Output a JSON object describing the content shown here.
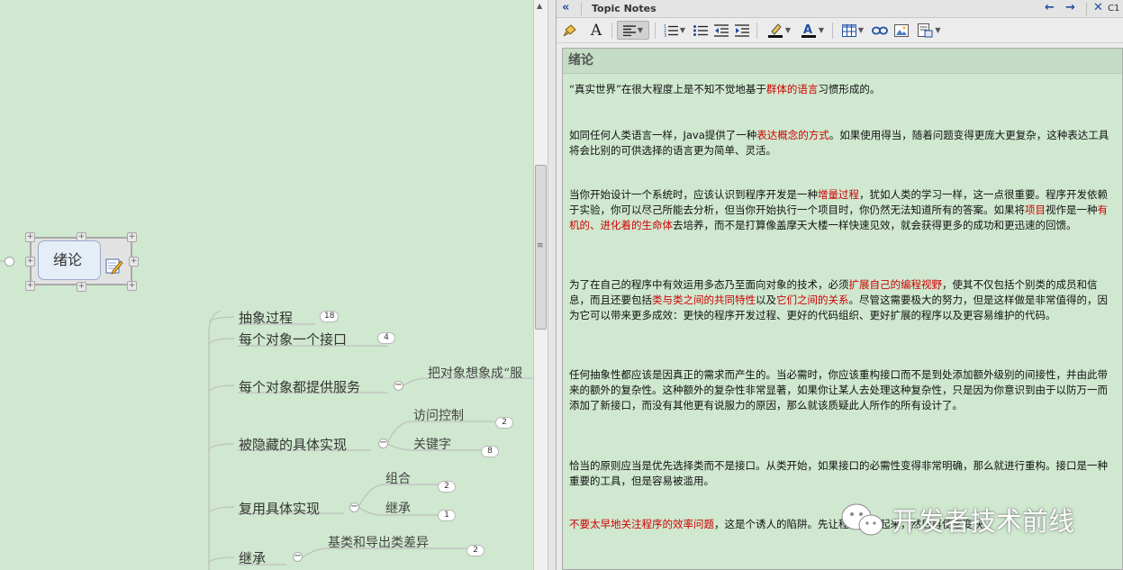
{
  "mindmap": {
    "root": {
      "label": "绪论"
    },
    "topics": [
      {
        "label": "抽象过程",
        "count": "18"
      },
      {
        "label": "每个对象一个接口",
        "count": "4"
      },
      {
        "label": "每个对象都提供服务",
        "child": "把对象想象成“服"
      },
      {
        "label": "被隐藏的具体实现",
        "children": [
          {
            "label": "访问控制",
            "count": "2"
          },
          {
            "label": "关键字",
            "count": "8"
          }
        ]
      },
      {
        "label": "复用具体实现",
        "children": [
          {
            "label": "组合",
            "count": "2"
          },
          {
            "label": "继承",
            "count": "1"
          }
        ]
      },
      {
        "label": "继承",
        "children": [
          {
            "label": "基类和导出类差异",
            "count": "2"
          }
        ]
      }
    ],
    "collapse_symbol": "−"
  },
  "notes_panel": {
    "title": "Topic Notes",
    "close_label": "C1",
    "doc_title": "绪论",
    "paragraphs": [
      [
        {
          "t": "“真实世界”在很大程度上是不知不觉地基于"
        },
        {
          "t": "群体的语言",
          "red": true
        },
        {
          "t": "习惯形成的。"
        }
      ],
      [
        {
          "t": "如同任何人类语言一样，Java提供了一种"
        },
        {
          "t": "表达概念的方式",
          "red": true
        },
        {
          "t": "。如果使用得当，随着问题变得更庞大更复杂，这种表达工具将会比别的可供选择的语言更为简单、灵活。"
        }
      ],
      [
        {
          "t": "当你开始设计一个系统时，应该认识到程序开发是一种"
        },
        {
          "t": "增量过程",
          "red": true
        },
        {
          "t": "，犹如人类的学习一样，这一点很重要。程序开发依赖于实验，你可以尽己所能去分析，但当你开始执行一个项目时，你仍然无法知道所有的答案。如果将"
        },
        {
          "t": "项目",
          "red": true
        },
        {
          "t": "视作是一种"
        },
        {
          "t": "有机的、进化着的生命体",
          "red": true
        },
        {
          "t": "去培养，而不是打算像盖摩天大楼一样快速见效，就会获得更多的成功和更迅速的回馈。"
        }
      ],
      [
        {
          "t": "为了在自己的程序中有效运用多态乃至面向对象的技术，必须"
        },
        {
          "t": "扩展自己的编程视野",
          "red": true
        },
        {
          "t": "，使其不仅包括个别类的成员和信息，而且还要包括"
        },
        {
          "t": "类与类之间的共同特性",
          "red": true
        },
        {
          "t": "以及"
        },
        {
          "t": "它们之间的关系",
          "red": true
        },
        {
          "t": "。尽管这需要极大的努力，但是这样做是非常值得的，因为它可以带来更多成效：更快的程序开发过程、更好的代码组织、更好扩展的程序以及更容易维护的代码。"
        }
      ],
      [
        {
          "t": "任何抽象性都应该是因真正的需求而产生的。当必需时，你应该重构接口而不是到处添加额外级别的间接性，并由此带来的额外的复杂性。这种额外的复杂性非常显著，如果你让某人去处理这种复杂性，只是因为你意识到由于以防万一而添加了新接口，而没有其他更有说服力的原因，那么就该质疑此人所作的所有设计了。"
        }
      ],
      [
        {
          "t": "恰当的原则应当是优先选择类而不是接口。从类开始，如果接口的必需性变得非常明确，那么就进行重构。接口是一种重要的工具，但是容易被滥用。"
        }
      ],
      [
        {
          "t": "不要太早地关注程序的效率问题",
          "red": true
        },
        {
          "t": "，这是个诱人的陷阱。先让程序运行起来，然后再使它变快。"
        }
      ]
    ]
  },
  "watermark": {
    "text": "开发者技术前线"
  },
  "colors": {
    "canvas": "#cfe8cf",
    "emphasis": "#d00000",
    "nav": "#1f4e9e"
  }
}
